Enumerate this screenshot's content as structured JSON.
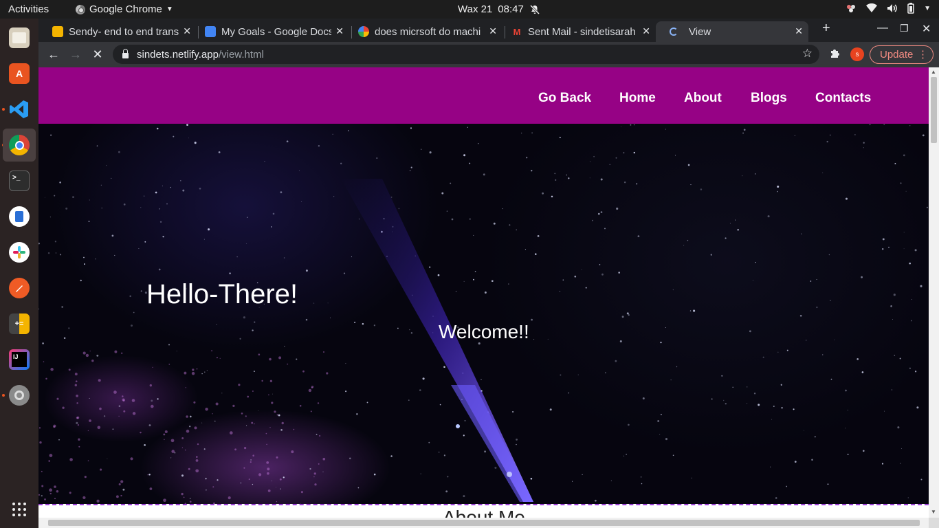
{
  "system_bar": {
    "activities": "Activities",
    "app_name": "Google Chrome",
    "date": "Wax 21",
    "time": "08:47"
  },
  "dock": {
    "apps": [
      {
        "name": "Files",
        "color": "#cfc8b8"
      },
      {
        "name": "Ubuntu Software",
        "color": "#e95420"
      },
      {
        "name": "Visual Studio Code",
        "color": "#1f8ad2"
      },
      {
        "name": "Google Chrome",
        "color": "#4285f4"
      },
      {
        "name": "Terminal",
        "color": "#333333"
      },
      {
        "name": "Notes",
        "color": "#2a6fd6"
      },
      {
        "name": "Slack",
        "color": "#ffffff"
      },
      {
        "name": "Postman",
        "color": "#ef5b25"
      },
      {
        "name": "Calculator",
        "color": "#f4b400"
      },
      {
        "name": "IntelliJ IDEA",
        "color": "#1c1c1c"
      },
      {
        "name": "Settings",
        "color": "#777777"
      }
    ]
  },
  "tabs": [
    {
      "title": "Sendy- end to end trans",
      "icon": "sendy-icon"
    },
    {
      "title": "My Goals - Google Docs",
      "icon": "google-docs-icon"
    },
    {
      "title": "does micrsoft do machi",
      "icon": "google-icon"
    },
    {
      "title": "Sent Mail - sindetisarah",
      "icon": "gmail-icon"
    },
    {
      "title": "View",
      "icon": "loading-icon"
    }
  ],
  "address_bar": {
    "host": "sindets.netlify.app",
    "path": "/view.html"
  },
  "toolbar": {
    "update_label": "Update",
    "profile_initial": "s"
  },
  "site": {
    "nav": [
      "Go Back",
      "Home",
      "About",
      "Blogs",
      "Contacts"
    ],
    "hero_title": "Hello-There!",
    "hero_subtitle": "Welcome!!",
    "about_title": "About Me"
  },
  "colors": {
    "nav_bg": "#960285",
    "update_accent": "#f28b82"
  }
}
